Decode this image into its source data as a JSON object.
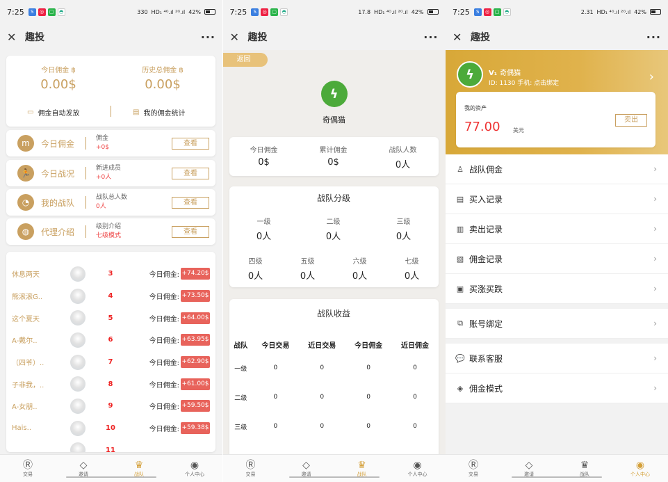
{
  "status": {
    "screen1": {
      "time": "7:25",
      "speed_top": "330",
      "speed_unit": "KB/S"
    },
    "screen2": {
      "time": "7:25",
      "speed_top": "17.8",
      "speed_unit": "KB/S"
    },
    "screen3": {
      "time": "7:25",
      "speed_top": "2.31",
      "speed_unit": "KB/S"
    },
    "net": "HD₁ ⁴ᴳ.ıl ²ᴳ.ıl",
    "battery": "42%"
  },
  "app_title": "趣投",
  "screen1": {
    "today_commission_label": "今日佣金",
    "today_commission_value": "0.00$",
    "history_commission_label": "历史总佣金",
    "history_commission_value": "0.00$",
    "auto_pay_label": "佣金自动发放",
    "my_stats_label": "我的佣金统计",
    "rows": [
      {
        "name": "今日佣金",
        "info": "佣金",
        "sub": "+0$",
        "btn": "查看"
      },
      {
        "name": "今日战况",
        "info": "新进成员",
        "sub": "+0人",
        "btn": "查看"
      },
      {
        "name": "我的战队",
        "info": "战队总人数",
        "sub": "0人",
        "btn": "查看"
      },
      {
        "name": "代理介绍",
        "info": "级别介绍",
        "sub": "七级模式",
        "btn": "查看"
      }
    ],
    "rank": [
      {
        "name": "休息两天",
        "num": "3",
        "label": "今日佣金:",
        "value": "+74.20$"
      },
      {
        "name": "熊滚滚G..",
        "num": "4",
        "label": "今日佣金:",
        "value": "+73.50$"
      },
      {
        "name": "这个夏天",
        "num": "5",
        "label": "今日佣金:",
        "value": "+64.00$"
      },
      {
        "name": "A-戴尔..",
        "num": "6",
        "label": "今日佣金:",
        "value": "+63.95$"
      },
      {
        "name": "（四爷）..",
        "num": "7",
        "label": "今日佣金:",
        "value": "+62.90$"
      },
      {
        "name": "子非我，..",
        "num": "8",
        "label": "今日佣金:",
        "value": "+61.00$"
      },
      {
        "name": "A-女朋..",
        "num": "9",
        "label": "今日佣金:",
        "value": "+59.50$"
      },
      {
        "name": "Hais..",
        "num": "10",
        "label": "今日佣金:",
        "value": "+59.38$"
      },
      {
        "name": "",
        "num": "11",
        "label": "",
        "value": ""
      }
    ]
  },
  "screen2": {
    "back_label": "返回",
    "team_name": "奇偶猫",
    "stats": [
      {
        "label": "今日佣金",
        "value": "0$"
      },
      {
        "label": "累计佣金",
        "value": "0$"
      },
      {
        "label": "战队人数",
        "value": "0人"
      }
    ],
    "levels_title": "战队分级",
    "levels_row1": [
      {
        "label": "一级",
        "value": "0人"
      },
      {
        "label": "二级",
        "value": "0人"
      },
      {
        "label": "三级",
        "value": "0人"
      }
    ],
    "levels_row2": [
      {
        "label": "四级",
        "value": "0人"
      },
      {
        "label": "五级",
        "value": "0人"
      },
      {
        "label": "六级",
        "value": "0人"
      },
      {
        "label": "七级",
        "value": "0人"
      }
    ],
    "income_title": "战队收益",
    "income_headers": [
      "战队",
      "今日交易",
      "近日交易",
      "今日佣金",
      "近日佣金"
    ],
    "income_rows": [
      [
        "一级",
        "0",
        "0",
        "0",
        "0"
      ],
      [
        "二级",
        "0",
        "0",
        "0",
        "0"
      ],
      [
        "三级",
        "0",
        "0",
        "0",
        "0"
      ]
    ]
  },
  "screen3": {
    "vip_badge": "V₁",
    "user_name": "奇偶猫",
    "user_id_line": "ID: 1130 手机: 点击绑定",
    "assets_label": "我的资产",
    "assets_amount": "77.00",
    "assets_unit": "美元",
    "sell_label": "卖出",
    "menu_group1": [
      {
        "label": "战队佣金",
        "icon": "user-icon"
      },
      {
        "label": "买入记录",
        "icon": "document-icon"
      },
      {
        "label": "卖出记录",
        "icon": "document-icon"
      },
      {
        "label": "佣金记录",
        "icon": "receipt-icon"
      },
      {
        "label": "买涨买跌",
        "icon": "card-icon"
      }
    ],
    "menu_group2": [
      {
        "label": "账号绑定",
        "icon": "copy-icon"
      }
    ],
    "menu_group3": [
      {
        "label": "联系客服",
        "icon": "chat-icon"
      },
      {
        "label": "佣金模式",
        "icon": "box-icon"
      }
    ]
  },
  "tabs": [
    {
      "label": "交易",
      "icon": "R"
    },
    {
      "label": "邀请",
      "icon": "◇"
    },
    {
      "label": "战队",
      "icon": "🏆"
    },
    {
      "label": "个人中心",
      "icon": "👤"
    }
  ],
  "colors": {
    "gold": "#c9a060",
    "red_badge": "#e8635b",
    "header_gold": "#d8a838",
    "logo_green": "#4caa3a"
  }
}
